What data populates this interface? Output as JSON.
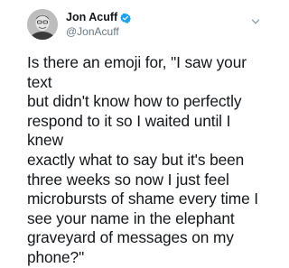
{
  "author": {
    "display_name": "Jon Acuff",
    "handle": "@JonAcuff",
    "verified": true
  },
  "icons": {
    "verified": "verified-badge-icon",
    "menu": "chevron-down-icon",
    "avatar": "profile-photo"
  },
  "colors": {
    "verified_blue": "#1da1f2",
    "handle_gray": "#657786",
    "text": "#14171a"
  },
  "tweet": {
    "text": "Is there an emoji for, \"I saw your text\nbut didn't know how to perfectly\nrespond to it so I waited until I knew\nexactly what to say but it's been\nthree weeks so now I just feel\nmicrobursts of shame every time I\nsee your name in the elephant\ngraveyard of messages on my\nphone?\""
  }
}
